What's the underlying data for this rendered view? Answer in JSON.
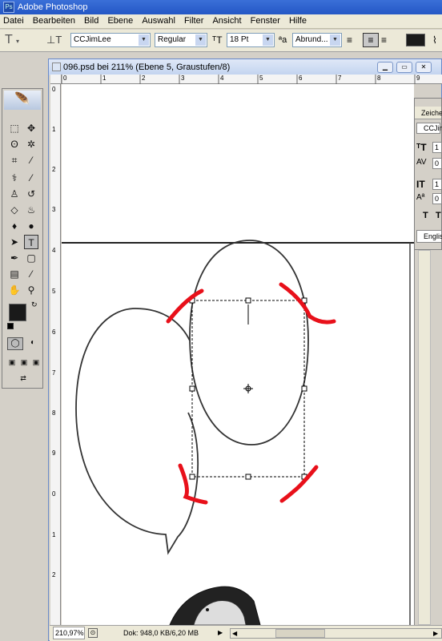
{
  "app": {
    "title": "Adobe Photoshop",
    "icon": "photoshop-icon"
  },
  "menu": [
    "Datei",
    "Bearbeiten",
    "Bild",
    "Ebene",
    "Auswahl",
    "Filter",
    "Ansicht",
    "Fenster",
    "Hilfe"
  ],
  "options": {
    "font_family": "CCJimLee",
    "font_style": "Regular",
    "font_size": "18 Pt",
    "antialias": "Abrund..."
  },
  "document": {
    "title": "096.psd bei 211% (Ebene 5, Graustufen/8)",
    "ruler_top": [
      "0",
      "1",
      "2",
      "3",
      "4",
      "5",
      "6",
      "7",
      "8",
      "9",
      "1"
    ],
    "ruler_left": [
      "0",
      "1",
      "2",
      "3",
      "4",
      "5",
      "6",
      "7",
      "8",
      "9",
      "0",
      "1",
      "2"
    ]
  },
  "status": {
    "zoom": "210,97%",
    "doc": "Dok: 948,0 KB/6,20 MB"
  },
  "character_panel": {
    "tab": "Zeiche",
    "font": "CCJim",
    "size": "1",
    "tracking": "0",
    "scale_v": "1",
    "baseline": "0",
    "language": "Englisc"
  },
  "colors": {
    "foreground": "#1a1a1a",
    "background": "#ffffff",
    "annotation": "#e8101a"
  }
}
